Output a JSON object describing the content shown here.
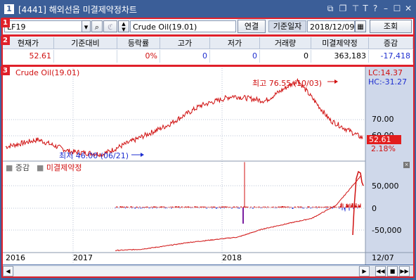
{
  "window": {
    "number": "1",
    "title": "[4441] 해외선옵 미결제약정차트"
  },
  "badges": [
    "1",
    "2",
    "3"
  ],
  "toolbar": {
    "symbol": "LF19",
    "name": "Crude Oil(19.01)",
    "connect_label": "연결",
    "date_label": "기준일자",
    "date_value": "2018/12/09",
    "query_label": "조회"
  },
  "table": {
    "headers": [
      "현재가",
      "기준대비",
      "등락률",
      "고가",
      "저가",
      "거래량",
      "미결제약정",
      "증감"
    ],
    "values": [
      "52.61",
      "",
      "0%",
      "0",
      "0",
      "0",
      "363,183",
      "-17,418"
    ]
  },
  "chart": {
    "title": "Crude Oil(19.01)",
    "lc": "LC:14.37",
    "hc": "HC:-31.27",
    "high_label": "최고 76.55 (10/03)",
    "low_label": "최저 46.00 (06/21)",
    "price_ticks": [
      "70.00",
      "60.00"
    ],
    "current_price": "52.61",
    "change_pct": "2.18%",
    "sub_legend_1": "증감",
    "sub_legend_2": "미결제약정",
    "sub_ticks": [
      "50,000",
      "0",
      "-50,000"
    ],
    "x_labels": [
      "2016",
      "2017",
      "2018",
      "12/07"
    ],
    "colors": {
      "price": "#d01010",
      "accent": "#e0202a",
      "oi_neg": "#1f2fd0"
    }
  },
  "chart_data": [
    {
      "type": "line",
      "title": "Crude Oil(19.01)",
      "x": [
        "2016",
        "2017",
        "2018",
        "12/07"
      ],
      "series": [
        {
          "values": [
            49.0,
            52.0,
            47.0,
            46.0,
            52.0,
            58.0,
            66.0,
            70.0,
            68.0,
            76.55,
            60.0,
            52.61
          ]
        }
      ],
      "annotations": [
        "최고 76.55 (10/03)",
        "최저 46.00 (06/21)"
      ],
      "ylim": [
        44,
        80
      ]
    },
    {
      "type": "area",
      "series": [
        {
          "name": "증감",
          "values": [
            0,
            0,
            0,
            0,
            0,
            -30000,
            90000,
            0,
            0,
            60000,
            -15000
          ]
        },
        {
          "name": "미결제약정",
          "values": [
            -80000,
            -78000,
            -72000,
            -65000,
            -60000,
            -55000,
            -40000,
            -30000,
            -20000,
            5000,
            60000
          ]
        }
      ],
      "ylim": [
        -80000,
        80000
      ]
    }
  ]
}
